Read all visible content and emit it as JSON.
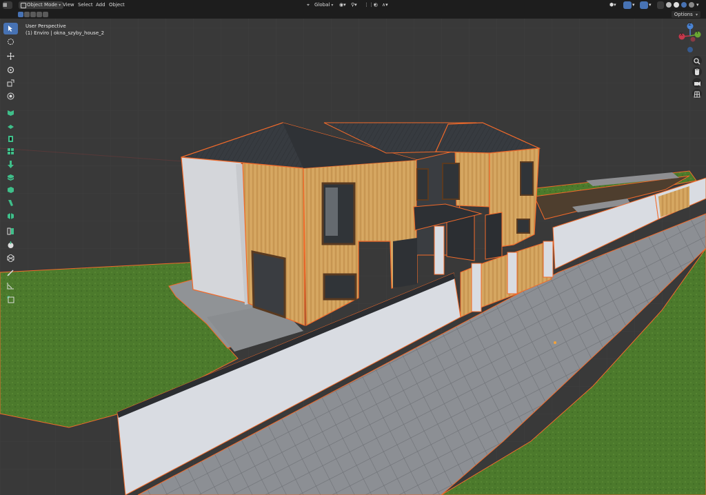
{
  "header": {
    "mode": "Object Mode",
    "menus": [
      "View",
      "Select",
      "Add",
      "Object"
    ],
    "transform_orientation": "Global",
    "options_label": "Options"
  },
  "viewport": {
    "view_name": "User Perspective",
    "collection_label": "(1) Enviro | okna_szyby_house_2"
  },
  "gizmo": {
    "x_label": "X",
    "y_label": "Y",
    "z_label": "Z"
  },
  "colors": {
    "accent_blue": "#4772b3",
    "selection_orange": "#f26a2a",
    "grass": "#4f7c2e",
    "wood": "#d7a963",
    "roof": "#363a3f",
    "wall": "#d9dce2",
    "pavement": "#8a8d92"
  },
  "toolbar_tools": [
    "select-box-icon",
    "cursor-icon",
    "move-icon",
    "rotate-icon",
    "scale-icon",
    "transform-icon",
    "add-cube-icon",
    "extrude-icon",
    "inset-icon",
    "bevel-icon",
    "loop-cut-icon",
    "knife-icon",
    "poly-build-icon",
    "spin-icon",
    "smooth-icon",
    "edge-slide-icon",
    "shrink-icon",
    "shear-icon",
    "rip-icon",
    "annotate-icon",
    "measure-icon",
    "add-object-icon"
  ]
}
